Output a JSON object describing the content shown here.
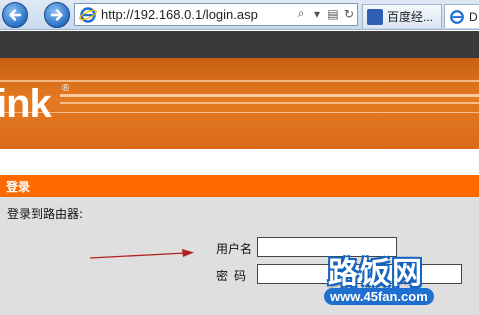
{
  "browser": {
    "url": "http://192.168.0.1/login.asp",
    "tabs": [
      {
        "label": "百度经..."
      },
      {
        "label": "D"
      }
    ]
  },
  "banner": {
    "brand_text": "ink",
    "registered_mark": "®"
  },
  "section": {
    "title": "登录"
  },
  "form": {
    "subtitle": "登录到路由器:",
    "username_label": "用户名",
    "password_label": "密码",
    "username_value": "",
    "password_value": ""
  },
  "watermark": {
    "logo": "路饭网",
    "url": "www.45fan.com"
  },
  "colors": {
    "section_header": "#ff6a00",
    "banner": "#e67a22",
    "arrow": "#b22222",
    "watermark_blue": "#1565c0"
  }
}
